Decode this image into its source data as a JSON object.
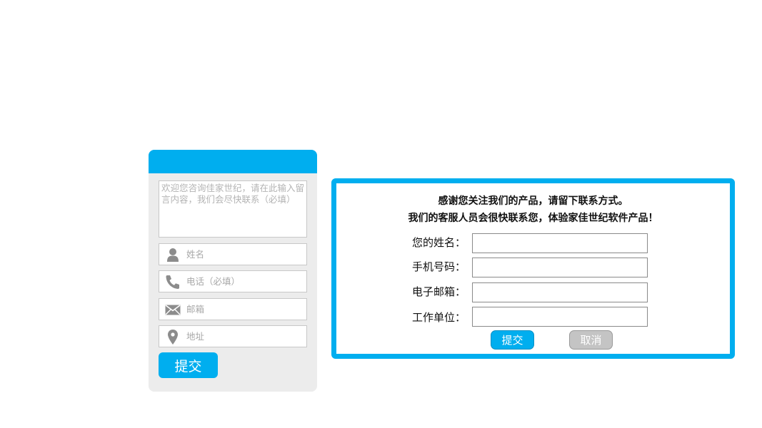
{
  "left_form": {
    "message_placeholder": "欢迎您咨询佳家世纪，请在此输入留言内容，我们会尽快联系（必填）",
    "fields": [
      {
        "icon": "person-icon",
        "placeholder": "姓名"
      },
      {
        "icon": "phone-icon",
        "placeholder": "电话（必填）"
      },
      {
        "icon": "mail-icon",
        "placeholder": "邮箱"
      },
      {
        "icon": "location-pin-icon",
        "placeholder": "地址"
      }
    ],
    "submit_label": "提交",
    "colors": {
      "accent": "#00aeef",
      "panel": "#ececec",
      "icon": "#8c8c8c"
    }
  },
  "contact_dialog": {
    "intro_line_1": "感谢您关注我们的产品，请留下联系方式。",
    "intro_line_2": "我们的客服人员会很快联系您，体验家佳世纪软件产品！",
    "fields": [
      {
        "label": "您的姓名："
      },
      {
        "label": "手机号码："
      },
      {
        "label": "电子邮箱："
      },
      {
        "label": "工作单位："
      }
    ],
    "submit_label": "提交",
    "cancel_label": "取消",
    "colors": {
      "border": "#00aeef",
      "submit": "#00aeef",
      "cancel": "#c4c4c4"
    }
  }
}
